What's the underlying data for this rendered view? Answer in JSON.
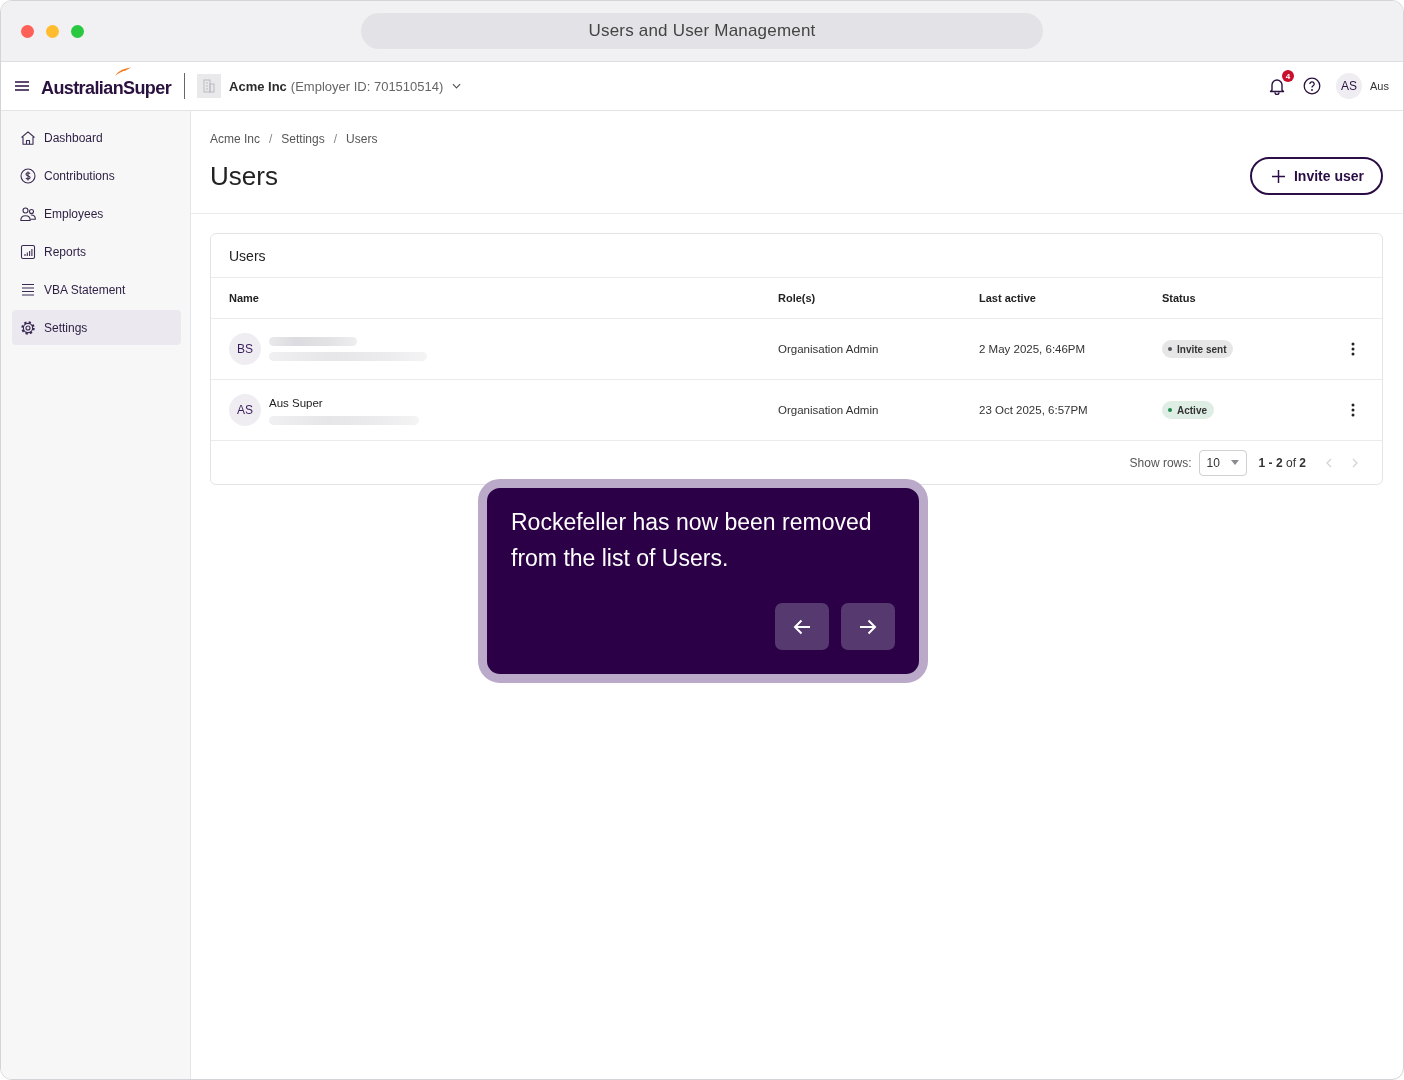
{
  "window": {
    "title": "Users and User Management"
  },
  "header": {
    "logo": "AustralianSuper",
    "employer": {
      "name": "Acme Inc",
      "id": "(Employer ID: 701510514)"
    },
    "notifications": "4",
    "avatar": "AS",
    "user_name": "Aus"
  },
  "sidebar": {
    "items": [
      {
        "label": "Dashboard",
        "selected": false
      },
      {
        "label": "Contributions",
        "selected": false
      },
      {
        "label": "Employees",
        "selected": false
      },
      {
        "label": "Reports",
        "selected": false
      },
      {
        "label": "VBA Statement",
        "selected": false
      },
      {
        "label": "Settings",
        "selected": true
      }
    ]
  },
  "breadcrumb": [
    {
      "label": "Acme Inc",
      "separator": "/"
    },
    {
      "label": "Settings",
      "separator": "/"
    },
    {
      "label": "Users"
    }
  ],
  "page": {
    "title": "Users",
    "invite_button": "Invite user"
  },
  "table": {
    "title": "Users",
    "columns": [
      "Name",
      "Role(s)",
      "Last active",
      "Status"
    ],
    "rows": [
      {
        "avatar": "BS",
        "name_redacted": true,
        "role": "Organisation Admin",
        "last_active": "2 May 2025, 6:46PM",
        "status": {
          "label": "Invite sent",
          "color": "#55555f"
        }
      },
      {
        "avatar": "AS",
        "name_redacted": false,
        "name": "Aus Super",
        "role": "Organisation Admin",
        "last_active": "23 Oct 2025, 6:57PM",
        "status": {
          "label": "Active",
          "color": "#1f8a4c"
        }
      }
    ],
    "footer": {
      "show_rows_label": "Show rows:",
      "rows_per_page": "10",
      "range": "**1 - 2** of **2**",
      "prev": {
        "disabled": true
      },
      "next": {
        "disabled": true
      }
    }
  },
  "tooltip": {
    "text": "Rockefeller has now been removed from the list of Users."
  }
}
